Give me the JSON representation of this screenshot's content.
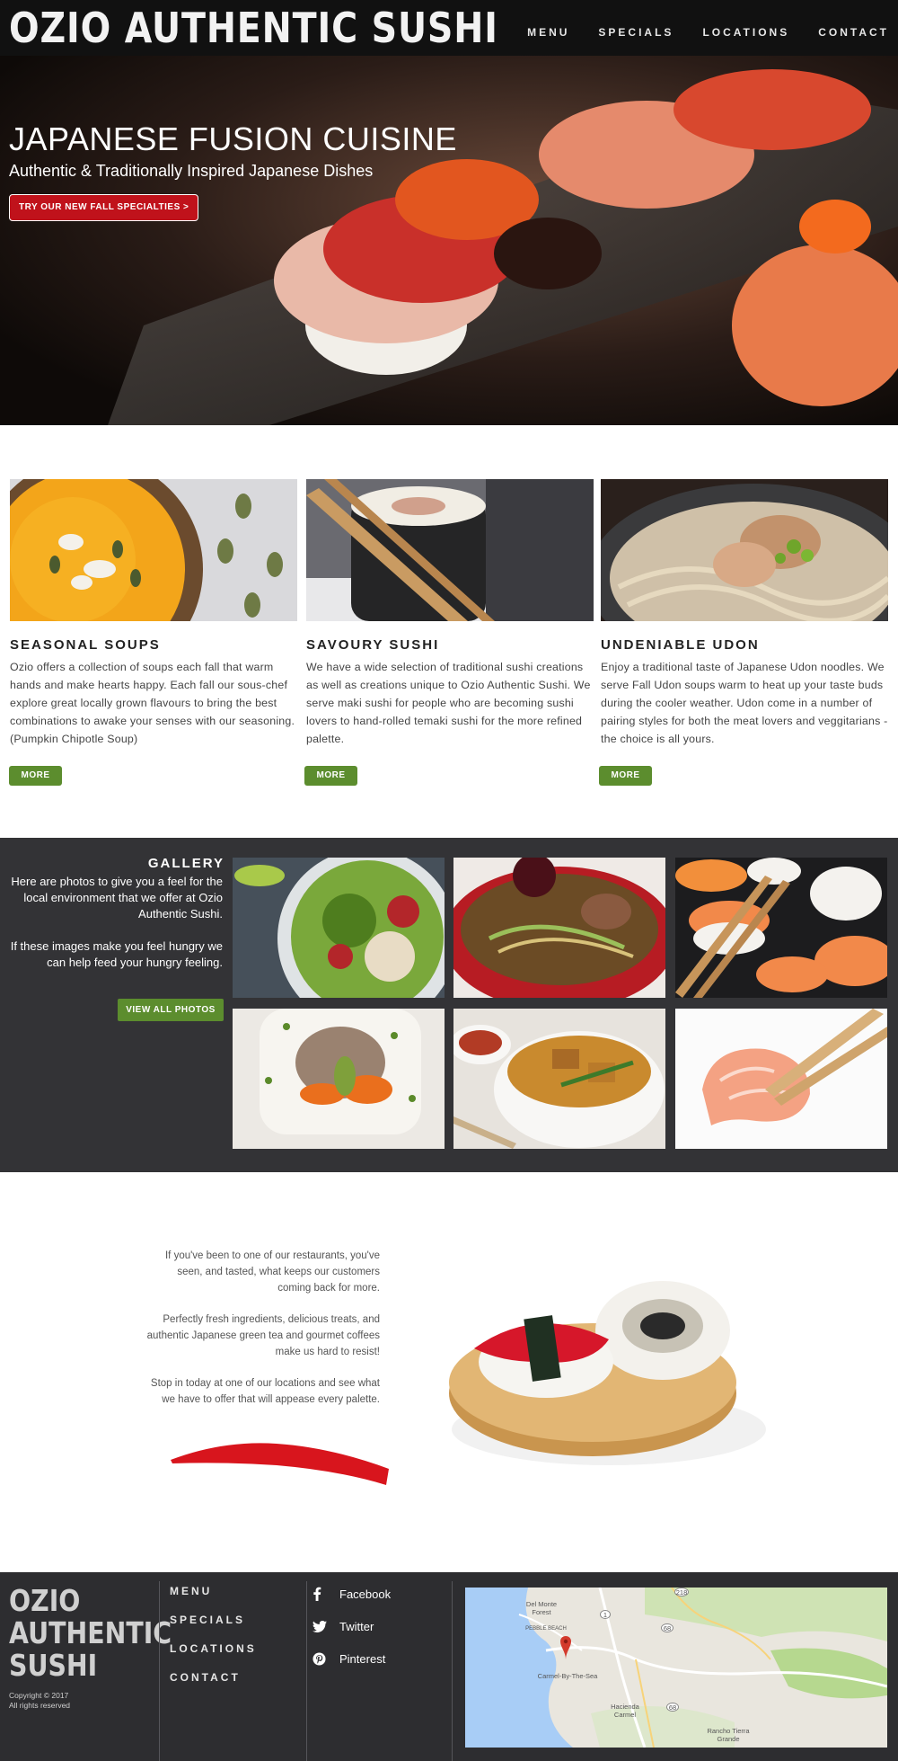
{
  "header": {
    "brand": "OZIO AUTHENTIC SUSHI",
    "nav": [
      "MENU",
      "SPECIALS",
      "LOCATIONS",
      "CONTACT"
    ]
  },
  "hero": {
    "title": "JAPANESE FUSION CUISINE",
    "subtitle": "Authentic & Traditionally Inspired Japanese Dishes",
    "button": "TRY OUR NEW FALL SPECIALTIES >"
  },
  "features": [
    {
      "title": "SEASONAL SOUPS",
      "text": "Ozio offers a collection of soups each fall that warm hands and make hearts happy. Each fall our sous-chef explore great locally grown flavours to bring the best combinations to awake your senses with our seasoning. (Pumpkin Chipotle Soup)",
      "button": "MORE"
    },
    {
      "title": "SAVOURY SUSHI",
      "text": "We have a wide selection of traditional sushi creations as well as creations unique to Ozio Authentic Sushi. We serve maki sushi for people who are becoming sushi lovers to hand-rolled temaki sushi for the more refined palette.",
      "button": "MORE"
    },
    {
      "title": "UNDENIABLE UDON",
      "text": "Enjoy a traditional taste of Japanese Udon noodles. We serve Fall Udon soups warm to heat up your taste buds during the cooler weather. Udon come in a number of pairing styles for both the meat lovers and veggitarians - the choice is all yours.",
      "button": "MORE"
    }
  ],
  "gallery": {
    "title": "GALLERY",
    "text1": "Here are photos to give you a feel for the local environment that we offer at Ozio Authentic Sushi.",
    "text2": "If these images make you feel hungry we can help feed your hungry feeling.",
    "button": "VIEW ALL PHOTOS"
  },
  "about": {
    "p1": "If you've been to one of our restaurants, you've seen, and tasted, what keeps our customers coming back for more.",
    "p2": "Perfectly fresh ingredients, delicious treats, and authentic Japanese green tea and gourmet coffees make us hard to resist!",
    "p3": "Stop in today at one of our locations and see  what we have to offer that will appease every palette."
  },
  "footer": {
    "logo": "OZIO AUTHENTIC SUSHI",
    "copyright": "Copyright © 2017",
    "rights": "All rights reserved",
    "nav": [
      "MENU",
      "SPECIALS",
      "LOCATIONS",
      "CONTACT"
    ],
    "social": [
      {
        "label": "Facebook",
        "icon": "facebook-icon"
      },
      {
        "label": "Twitter",
        "icon": "twitter-icon"
      },
      {
        "label": "Pinterest",
        "icon": "pinterest-icon"
      }
    ],
    "map": {
      "labels": [
        "Del Monte Forest",
        "PEBBLE BEACH",
        "Carmel-By-The-Sea",
        "Hacienda Carmel",
        "Rancho Tierra Grande"
      ],
      "shields": [
        "1",
        "68",
        "218",
        "68"
      ]
    }
  },
  "colors": {
    "header_bg": "#111111",
    "accent_red": "#c0121b",
    "button_green": "#5c8d2e",
    "gallery_bg": "#333336",
    "footer_bg": "#2d2d30"
  }
}
